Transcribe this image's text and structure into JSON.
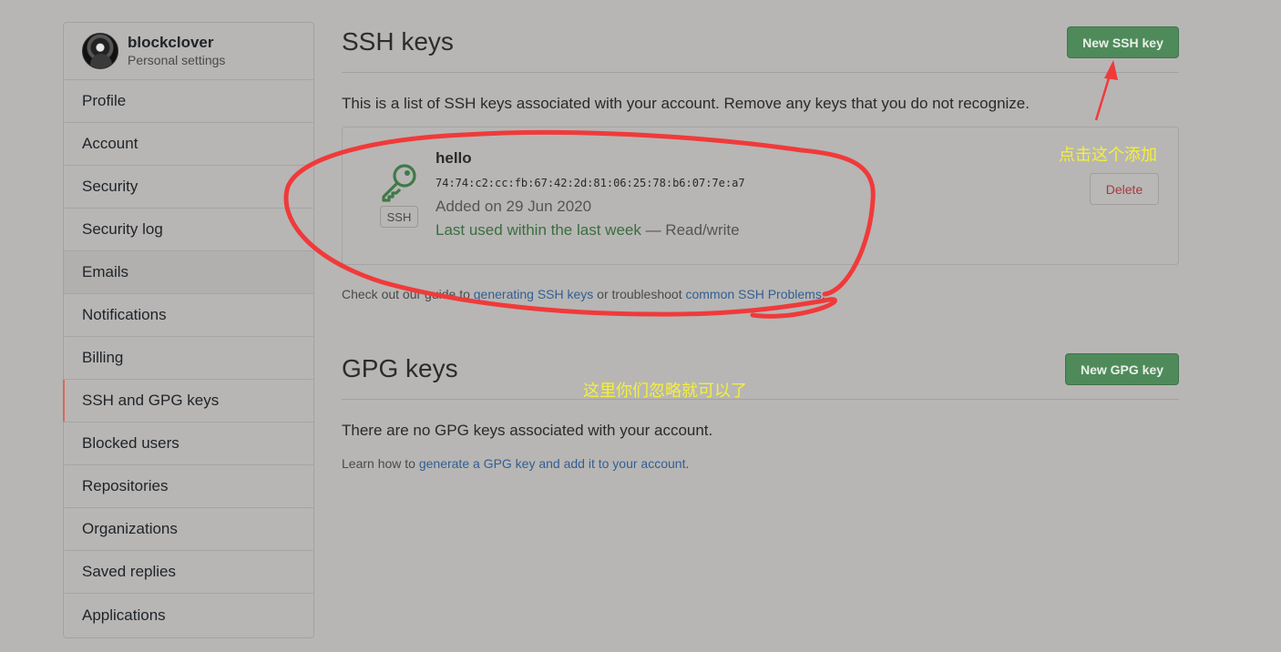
{
  "sidebar": {
    "username": "blockclover",
    "subtitle": "Personal settings",
    "items": [
      {
        "label": "Profile"
      },
      {
        "label": "Account"
      },
      {
        "label": "Security"
      },
      {
        "label": "Security log"
      },
      {
        "label": "Emails"
      },
      {
        "label": "Notifications"
      },
      {
        "label": "Billing"
      },
      {
        "label": "SSH and GPG keys"
      },
      {
        "label": "Blocked users"
      },
      {
        "label": "Repositories"
      },
      {
        "label": "Organizations"
      },
      {
        "label": "Saved replies"
      },
      {
        "label": "Applications"
      }
    ]
  },
  "ssh": {
    "title": "SSH keys",
    "new_button": "New SSH key",
    "description": "This is a list of SSH keys associated with your account. Remove any keys that you do not recognize.",
    "key": {
      "badge": "SSH",
      "name": "hello",
      "fingerprint": "74:74:c2:cc:fb:67:42:2d:81:06:25:78:b6:07:7e:a7",
      "added": "Added on 29 Jun 2020",
      "last_used": "Last used within the last week",
      "access": " — Read/write",
      "delete_label": "Delete"
    },
    "guide_prefix": "Check out our guide to ",
    "guide_link1": "generating SSH keys",
    "guide_middle": " or troubleshoot ",
    "guide_link2": "common SSH Problems",
    "guide_suffix": "."
  },
  "gpg": {
    "title": "GPG keys",
    "new_button": "New GPG key",
    "description": "There are no GPG keys associated with your account.",
    "learn_prefix": "Learn how to ",
    "learn_link": "generate a GPG key and add it to your account",
    "learn_suffix": "."
  },
  "annotations": {
    "add_hint": "点击这个添加",
    "ignore_hint": "这里你们忽略就可以了",
    "color": "#f5ef3c",
    "marker_color": "#f03a3a"
  }
}
